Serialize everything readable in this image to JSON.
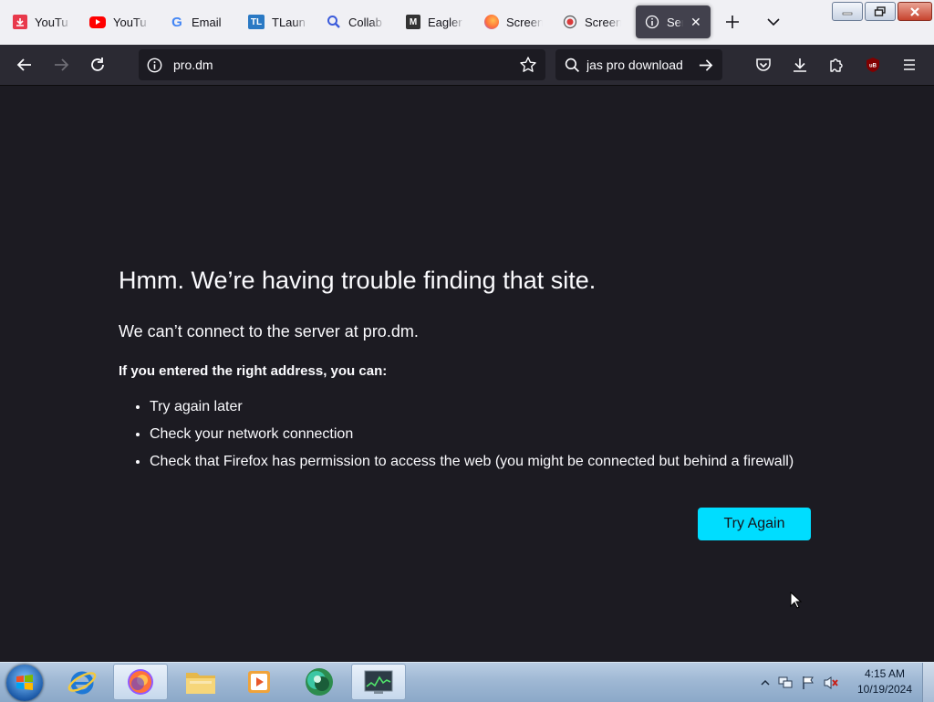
{
  "tabs": [
    {
      "title": "YouTu",
      "icon": "download-icon",
      "color": "#e8394b"
    },
    {
      "title": "YouTu",
      "icon": "youtube-icon",
      "color": "#ff0000"
    },
    {
      "title": "Email",
      "icon": "google-icon",
      "color": "#4285f4"
    },
    {
      "title": "TLaun",
      "icon": "tlauncher-icon",
      "color": "#2a79c4"
    },
    {
      "title": "Collab",
      "icon": "search-icon",
      "color": "#3b5bdb"
    },
    {
      "title": "Eagler",
      "icon": "m-logo-icon",
      "color": "#333333"
    },
    {
      "title": "Screen",
      "icon": "firefox-icon",
      "color": "#ff7139"
    },
    {
      "title": "Screen",
      "icon": "record-icon",
      "color": "#d93a3a"
    },
    {
      "title": "Ser",
      "icon": "info-icon",
      "color": "#fbfbfe",
      "active": true
    }
  ],
  "navbar": {
    "url": "pro.dm",
    "search_query": "jas pro download"
  },
  "error": {
    "title": "Hmm. We’re having trouble finding that site.",
    "description": "We can’t connect to the server at pro.dm.",
    "subtitle": "If you entered the right address, you can:",
    "suggestions": [
      "Try again later",
      "Check your network connection",
      "Check that Firefox has permission to access the web (you might be connected but behind a firewall)"
    ],
    "button_label": "Try Again",
    "button_color": "#00ddff"
  },
  "taskbar": {
    "time": "4:15 AM",
    "date": "10/19/2024",
    "pinned": [
      "internet-explorer-icon",
      "firefox-icon",
      "file-explorer-icon",
      "media-player-icon",
      "app-icon",
      "task-manager-icon"
    ]
  }
}
